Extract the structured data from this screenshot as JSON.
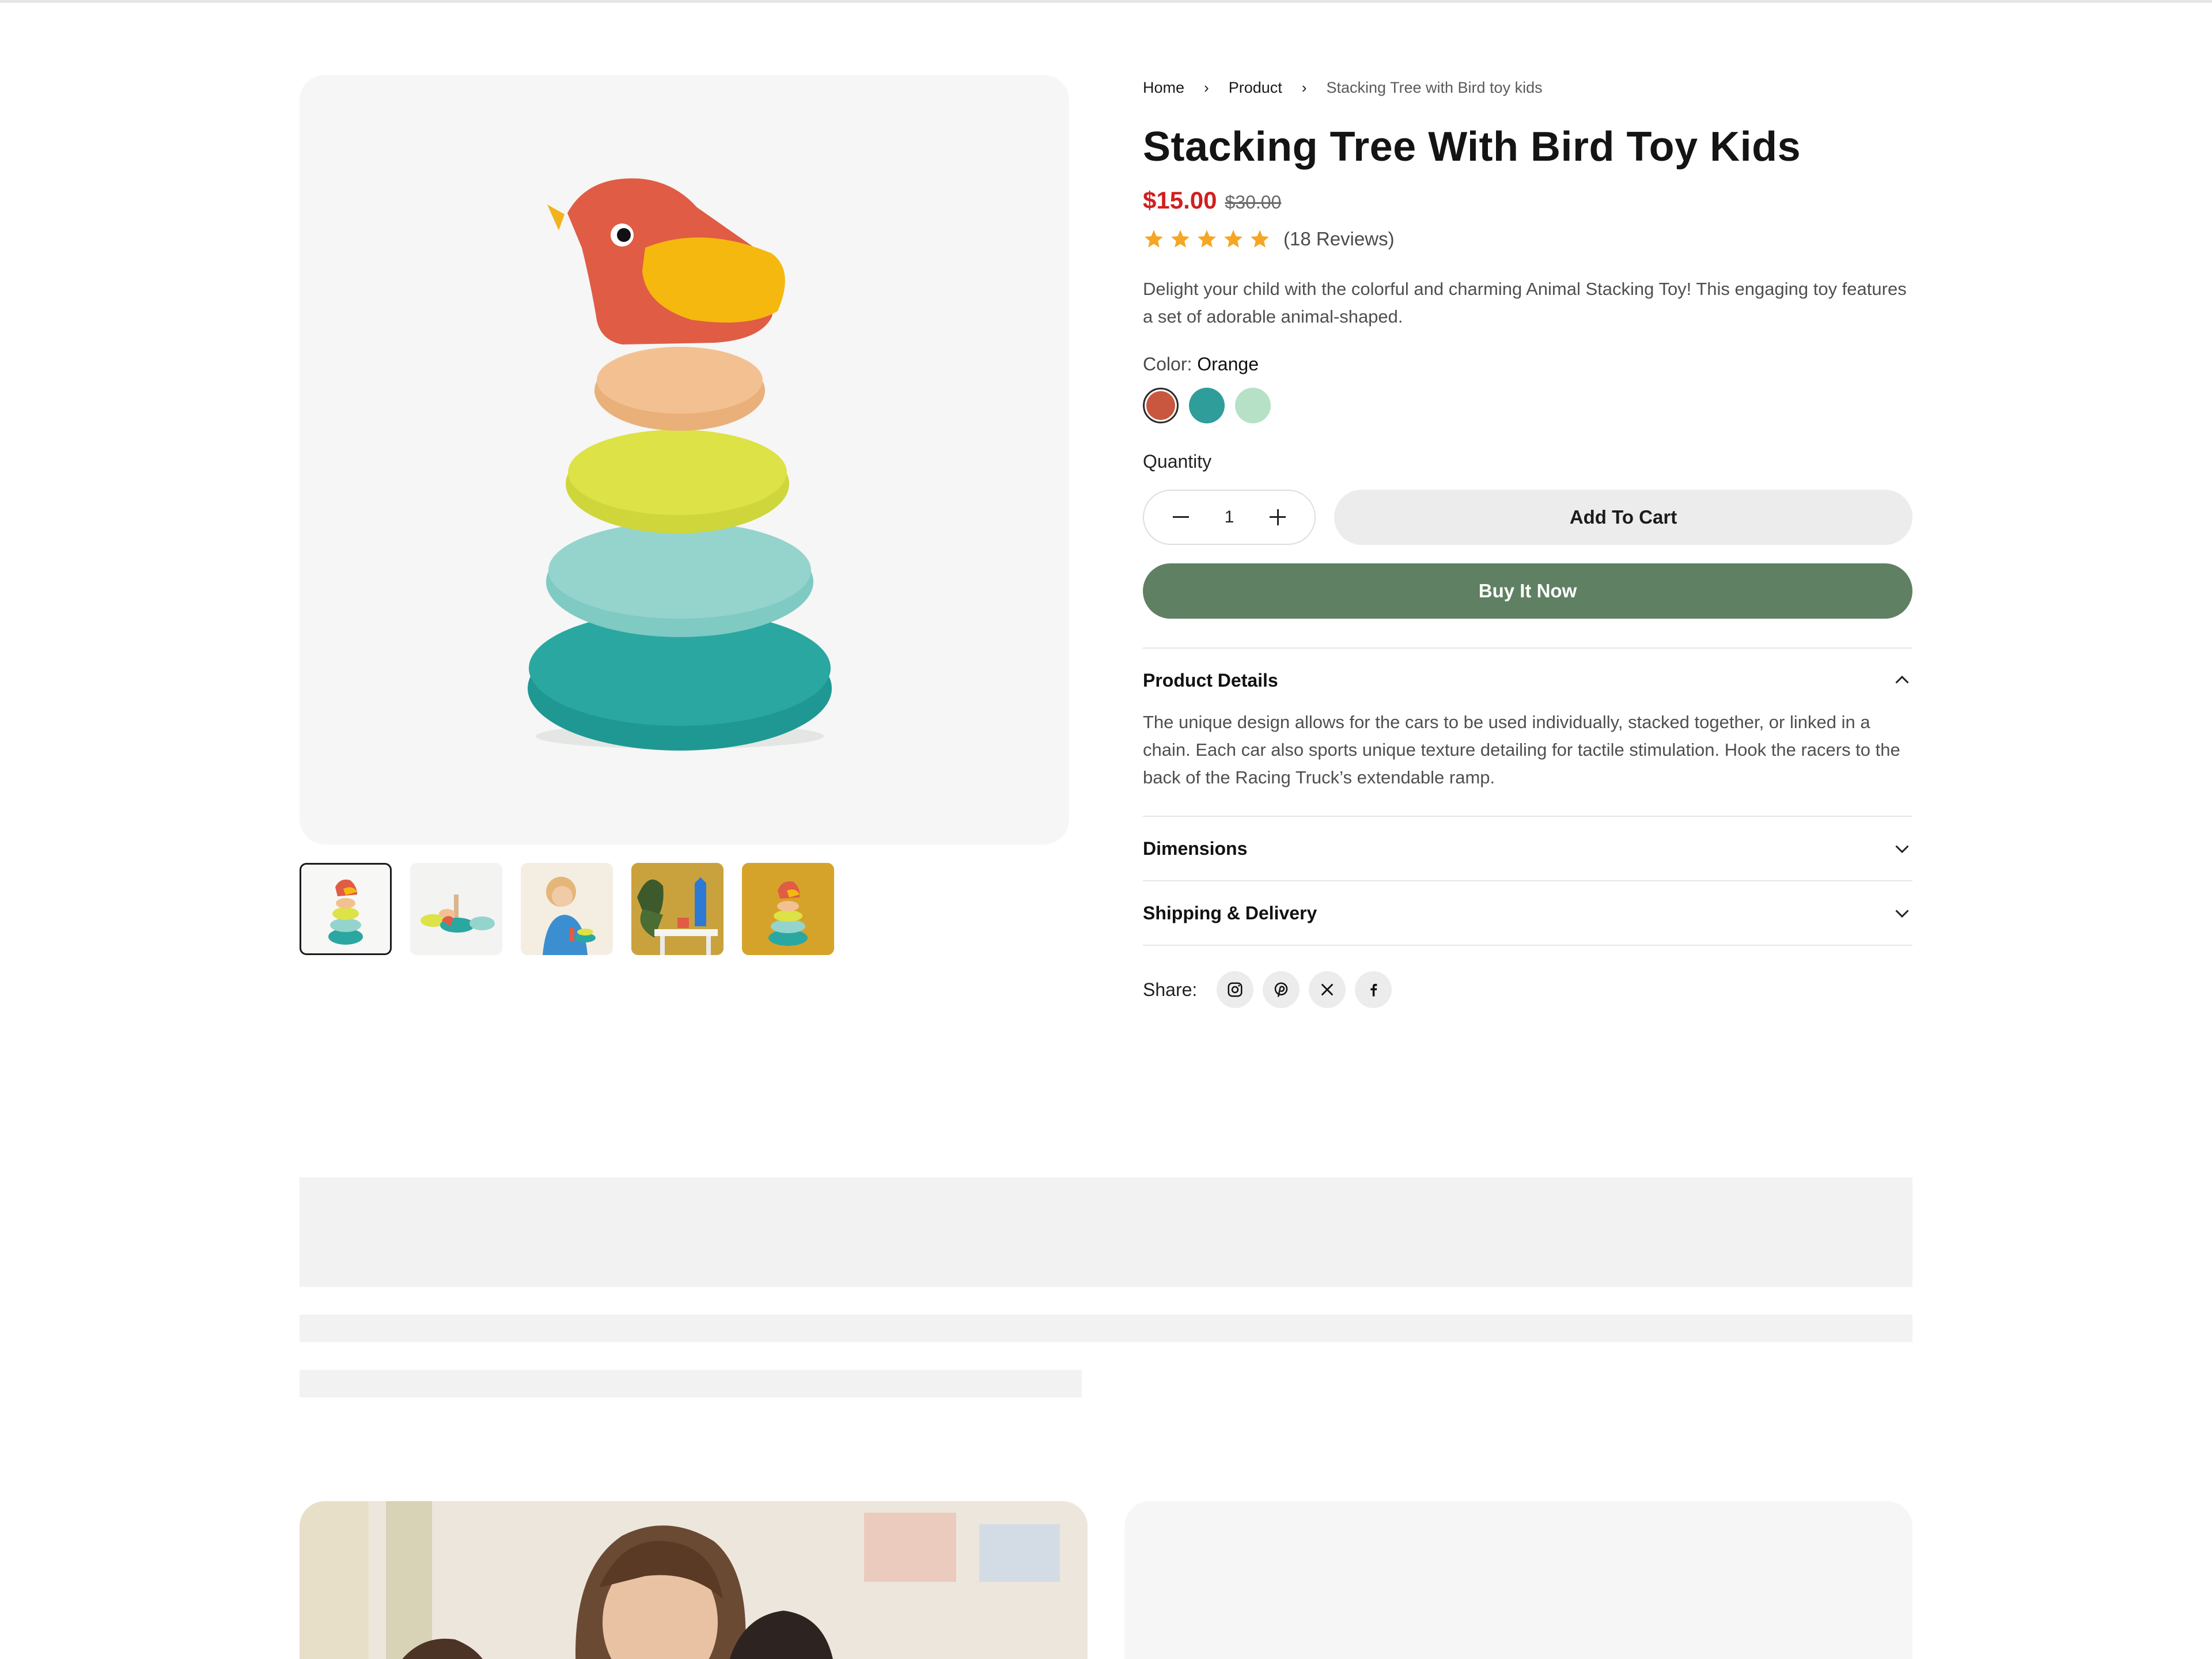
{
  "breadcrumb": {
    "home": "Home",
    "product": "Product",
    "current": "Stacking Tree with Bird toy kids"
  },
  "product": {
    "title": "Stacking Tree With Bird Toy Kids",
    "price": "$15.00",
    "compare_price": "$30.00",
    "rating_stars": 5,
    "reviews": "(18 Reviews)",
    "description": "Delight your child with the colorful and charming Animal Stacking Toy! This engaging toy features a set of adorable animal-shaped.",
    "color_label": "Color:",
    "color_value": "Orange",
    "swatches": [
      "#c9563f",
      "#2f9e9a",
      "#b7e1c6"
    ],
    "quantity_label": "Quantity",
    "quantity": "1",
    "add_to_cart": "Add To Cart",
    "buy_now": "Buy It Now"
  },
  "accordion": {
    "details_title": "Product Details",
    "details_body": "The unique design allows for the cars to be used individually, stacked together, or linked in a chain. Each car also sports unique texture detailing for tactile stimulation. Hook the racers to the back of the Racing Truck’s extendable ramp.",
    "dimensions_title": "Dimensions",
    "shipping_title": "Shipping & Delivery"
  },
  "share": {
    "label": "Share:",
    "icons": [
      "instagram-icon",
      "pinterest-icon",
      "x-icon",
      "facebook-icon"
    ]
  },
  "colors": {
    "accent_green": "#5f8062",
    "sale_red": "#d11f1f",
    "star": "#f5a623"
  }
}
